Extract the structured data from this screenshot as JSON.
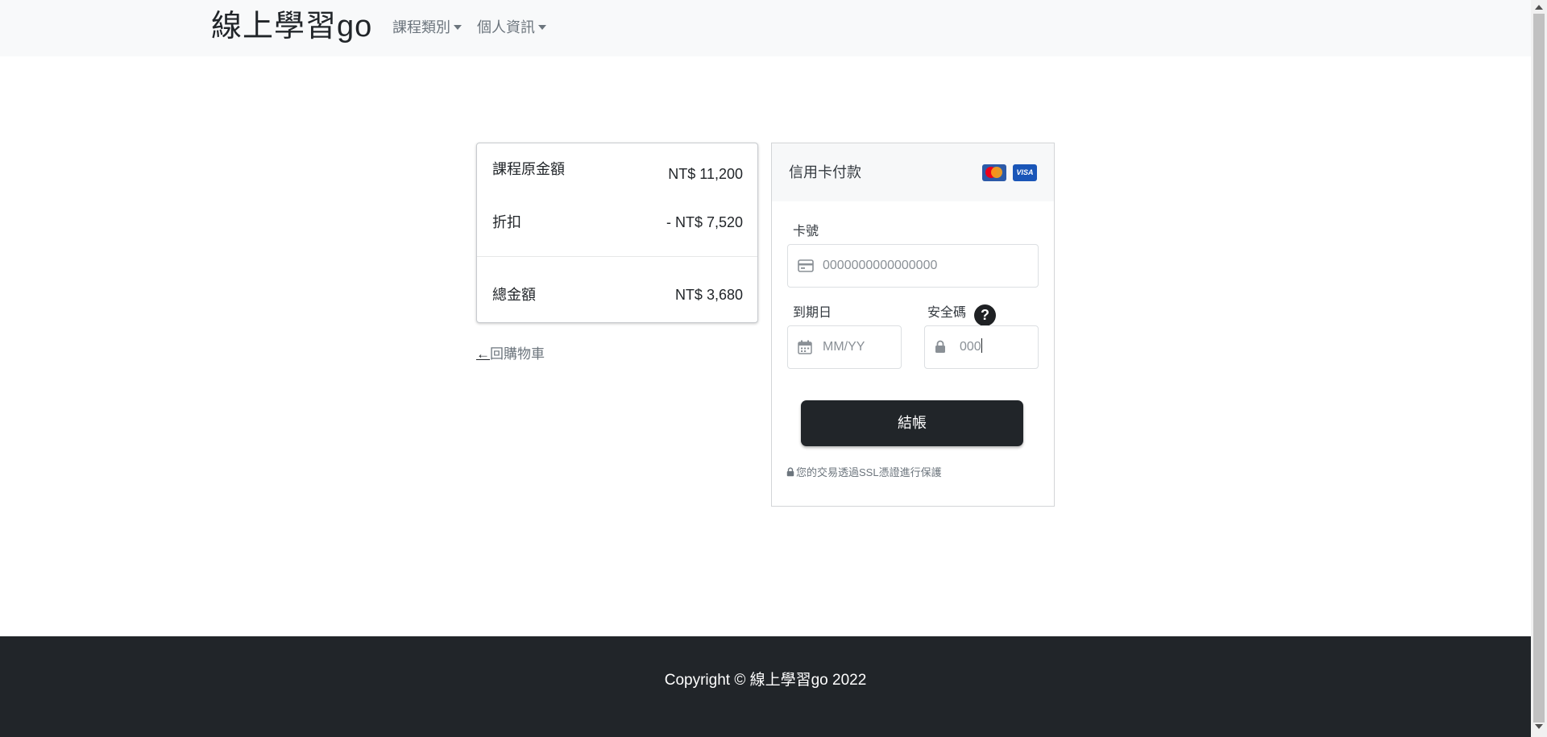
{
  "navbar": {
    "brand": "線上學習go",
    "menu": [
      {
        "label": "課程類別"
      },
      {
        "label": "個人資訊"
      }
    ]
  },
  "summary": {
    "rows": [
      {
        "label": "課程原金額",
        "value": "NT$ 11,200"
      },
      {
        "label": "折扣",
        "value": "- NT$ 7,520"
      },
      {
        "label": "總金額",
        "value": "NT$ 3,680"
      }
    ],
    "back_arrow": "←",
    "back_label": "回購物車"
  },
  "payment": {
    "title": "信用卡付款",
    "card_icons": [
      "mastercard-icon",
      "visa-icon"
    ],
    "visa_text": "VISA",
    "card_number": {
      "label": "卡號",
      "placeholder": "0000000000000000"
    },
    "expiry": {
      "label": "到期日",
      "placeholder": "MM/YY"
    },
    "cvc": {
      "label": "安全碼",
      "value": "000",
      "help": "?"
    },
    "submit_label": "結帳",
    "ssl_note": "您的交易透過SSL憑證進行保護"
  },
  "footer": {
    "copyright": "Copyright © 線上學習go 2022"
  },
  "colors": {
    "navbar_bg": "#f8f9fa",
    "footer_bg": "#212529",
    "button_bg": "#212529",
    "muted_text": "#6c757d"
  }
}
